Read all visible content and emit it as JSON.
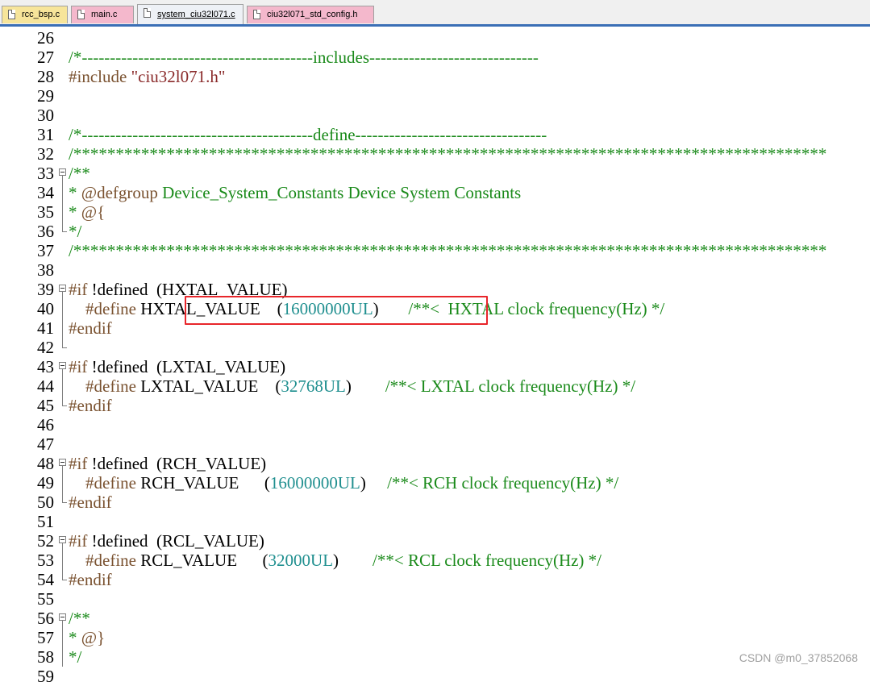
{
  "tabs": [
    {
      "label": "rcc_bsp.c",
      "color": "#f7e59a",
      "active": false
    },
    {
      "label": "main.c",
      "color": "#f4b8cc",
      "active": false
    },
    {
      "label": "system_ciu32l071.c",
      "color": "#eef1f6",
      "active": true
    },
    {
      "label": "ciu32l071_std_config.h",
      "color": "#f4b8cc",
      "active": false
    }
  ],
  "colors": {
    "comment": "#1a8a1a",
    "preprocessor": "#7a5230",
    "string": "#8a2a2a",
    "number": "#1f8f8f",
    "highlight_box": "#e8262b",
    "tab_accent": "#3b6fb6"
  },
  "code": [
    {
      "n": "26",
      "fold": "none",
      "segs": []
    },
    {
      "n": "27",
      "fold": "none",
      "segs": [
        {
          "t": "/*-----------------------------------------includes------------------------------",
          "c": "comment"
        }
      ]
    },
    {
      "n": "28",
      "fold": "none",
      "segs": [
        {
          "t": "#include ",
          "c": "pre"
        },
        {
          "t": "\"ciu32l071.h\"",
          "c": "str"
        }
      ]
    },
    {
      "n": "29",
      "fold": "none",
      "segs": []
    },
    {
      "n": "30",
      "fold": "none",
      "segs": []
    },
    {
      "n": "31",
      "fold": "none",
      "segs": [
        {
          "t": "/*-----------------------------------------define----------------------------------",
          "c": "comment"
        }
      ]
    },
    {
      "n": "32",
      "fold": "none",
      "segs": [
        {
          "t": "/*****************************************************************************************",
          "c": "comment"
        }
      ]
    },
    {
      "n": "33",
      "fold": "start",
      "segs": [
        {
          "t": "/**",
          "c": "comment"
        }
      ]
    },
    {
      "n": "34",
      "fold": "mid",
      "segs": [
        {
          "t": "* ",
          "c": "comment"
        },
        {
          "t": "@defgroup",
          "c": "pre"
        },
        {
          "t": " Device_System_Constants Device System Constants",
          "c": "comment"
        }
      ]
    },
    {
      "n": "35",
      "fold": "mid",
      "segs": [
        {
          "t": "* ",
          "c": "comment"
        },
        {
          "t": "@{",
          "c": "pre"
        }
      ]
    },
    {
      "n": "36",
      "fold": "end",
      "segs": [
        {
          "t": "*/",
          "c": "comment"
        }
      ]
    },
    {
      "n": "37",
      "fold": "none",
      "segs": [
        {
          "t": "/*****************************************************************************************",
          "c": "comment"
        }
      ]
    },
    {
      "n": "38",
      "fold": "none",
      "segs": []
    },
    {
      "n": "39",
      "fold": "start",
      "segs": [
        {
          "t": "#if",
          "c": "pre"
        },
        {
          "t": " !defined  (HXTAL_VALUE)",
          "c": "plain"
        }
      ]
    },
    {
      "n": "40",
      "fold": "mid",
      "segs": [
        {
          "t": "    #define",
          "c": "pre"
        },
        {
          "t": " HXTAL_VALUE    ",
          "c": "plain"
        },
        {
          "t": "(",
          "c": "plain"
        },
        {
          "t": "16000000UL",
          "c": "num"
        },
        {
          "t": ")       ",
          "c": "plain"
        },
        {
          "t": "/**<  HXTAL clock frequency(Hz) */",
          "c": "comment"
        }
      ]
    },
    {
      "n": "41",
      "fold": "mid",
      "segs": [
        {
          "t": "#endif",
          "c": "pre"
        }
      ]
    },
    {
      "n": "42",
      "fold": "end",
      "segs": []
    },
    {
      "n": "43",
      "fold": "start",
      "segs": [
        {
          "t": "#if",
          "c": "pre"
        },
        {
          "t": " !defined  (LXTAL_VALUE)",
          "c": "plain"
        }
      ]
    },
    {
      "n": "44",
      "fold": "mid",
      "segs": [
        {
          "t": "    #define",
          "c": "pre"
        },
        {
          "t": " LXTAL_VALUE    ",
          "c": "plain"
        },
        {
          "t": "(",
          "c": "plain"
        },
        {
          "t": "32768UL",
          "c": "num"
        },
        {
          "t": ")        ",
          "c": "plain"
        },
        {
          "t": "/**< LXTAL clock frequency(Hz) */",
          "c": "comment"
        }
      ]
    },
    {
      "n": "45",
      "fold": "end",
      "segs": [
        {
          "t": "#endif",
          "c": "pre"
        }
      ]
    },
    {
      "n": "46",
      "fold": "none",
      "segs": []
    },
    {
      "n": "47",
      "fold": "none",
      "segs": []
    },
    {
      "n": "48",
      "fold": "start",
      "segs": [
        {
          "t": "#if",
          "c": "pre"
        },
        {
          "t": " !defined  (RCH_VALUE)",
          "c": "plain"
        }
      ]
    },
    {
      "n": "49",
      "fold": "mid",
      "segs": [
        {
          "t": "    #define",
          "c": "pre"
        },
        {
          "t": " RCH_VALUE      ",
          "c": "plain"
        },
        {
          "t": "(",
          "c": "plain"
        },
        {
          "t": "16000000UL",
          "c": "num"
        },
        {
          "t": ")     ",
          "c": "plain"
        },
        {
          "t": "/**< RCH clock frequency(Hz) */",
          "c": "comment"
        }
      ]
    },
    {
      "n": "50",
      "fold": "end",
      "segs": [
        {
          "t": "#endif",
          "c": "pre"
        }
      ]
    },
    {
      "n": "51",
      "fold": "none",
      "segs": []
    },
    {
      "n": "52",
      "fold": "start",
      "segs": [
        {
          "t": "#if",
          "c": "pre"
        },
        {
          "t": " !defined  (RCL_VALUE)",
          "c": "plain"
        }
      ]
    },
    {
      "n": "53",
      "fold": "mid",
      "segs": [
        {
          "t": "    #define",
          "c": "pre"
        },
        {
          "t": " RCL_VALUE      ",
          "c": "plain"
        },
        {
          "t": "(",
          "c": "plain"
        },
        {
          "t": "32000UL",
          "c": "num"
        },
        {
          "t": ")        ",
          "c": "plain"
        },
        {
          "t": "/**< RCL clock frequency(Hz) */",
          "c": "comment"
        }
      ]
    },
    {
      "n": "54",
      "fold": "end",
      "segs": [
        {
          "t": "#endif",
          "c": "pre"
        }
      ]
    },
    {
      "n": "55",
      "fold": "none",
      "segs": []
    },
    {
      "n": "56",
      "fold": "start",
      "segs": [
        {
          "t": "/**",
          "c": "comment"
        }
      ]
    },
    {
      "n": "57",
      "fold": "mid",
      "segs": [
        {
          "t": "* ",
          "c": "comment"
        },
        {
          "t": "@}",
          "c": "pre"
        }
      ]
    },
    {
      "n": "58",
      "fold": "mid",
      "segs": [
        {
          "t": "*/",
          "c": "comment"
        }
      ]
    },
    {
      "n": "59",
      "fold": "none",
      "segs": []
    }
  ],
  "watermark": "CSDN @m0_37852068"
}
